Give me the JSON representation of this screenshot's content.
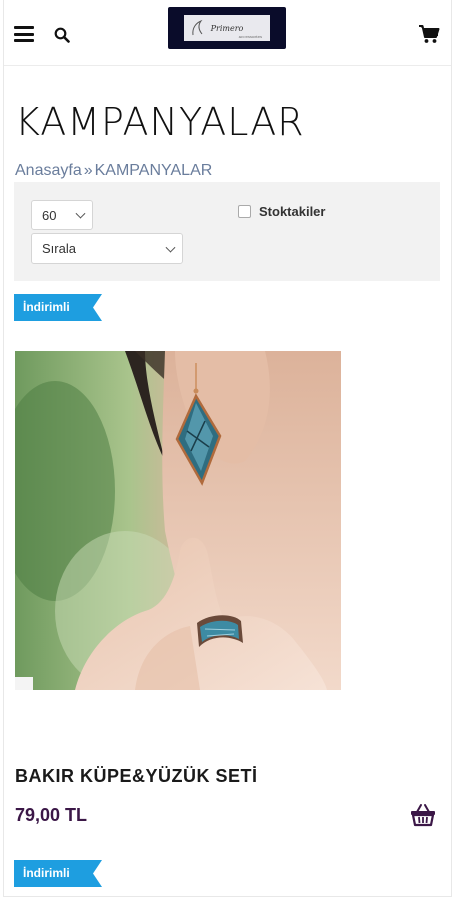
{
  "header": {
    "menu_icon": "hamburger-menu-icon",
    "search_icon": "search-icon",
    "logo_text": "Primero",
    "logo_subtext": "accessories",
    "cart_icon": "shopping-cart-icon"
  },
  "page": {
    "title": "KAMPANYALAR",
    "breadcrumb": {
      "home": "Anasayfa",
      "separator": "»",
      "current": "KAMPANYALAR"
    }
  },
  "filters": {
    "per_page_value": "60",
    "sort_value": "Sırala",
    "in_stock_label": "Stoktakiler",
    "in_stock_checked": false
  },
  "badges": {
    "discount_label": "İndirimli",
    "color": "#1e9ee0"
  },
  "products": [
    {
      "name": "BAKIR KÜPE&YÜZÜK SETİ",
      "price": "79,00 TL",
      "basket_icon": "shopping-basket-icon"
    }
  ],
  "colors": {
    "accent": "#3b1747",
    "breadcrumb": "#6a7d9c",
    "badge": "#1e9ee0",
    "filter_bg": "#f2f2f2"
  }
}
